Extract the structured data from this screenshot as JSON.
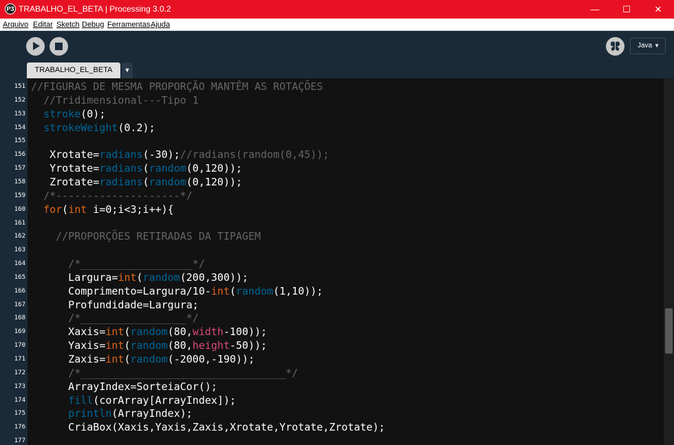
{
  "window": {
    "app_icon": "P3",
    "title": "TRABALHO_EL_BETA | Processing 3.0.2",
    "minimize": "—",
    "maximize": "☐",
    "close": "✕"
  },
  "menu": [
    "Arquivo",
    "Editar",
    "Sketch",
    "Debug",
    "Ferramentas",
    "Ajuda"
  ],
  "toolbar": {
    "mode_label": "Java",
    "mode_arrow": "▼"
  },
  "tabs": {
    "active": "TRABALHO_EL_BETA",
    "menu_arrow": "▼"
  },
  "colors": {
    "titlebar": "#e81123",
    "toolbar": "#1b2a38",
    "editor_bg": "#121212",
    "comment": "#666666",
    "function": "#006699",
    "keyword": "#e2661a",
    "variable": "#d94a7a"
  },
  "editor": {
    "lines": [
      {
        "n": "151",
        "tokens": [
          {
            "t": "c",
            "v": "//FIGURAS DE MESMA PROPORÇÃO MANTÊM AS ROTAÇÕES"
          }
        ]
      },
      {
        "n": "152",
        "tokens": [
          {
            "t": "x",
            "v": "  "
          },
          {
            "t": "c",
            "v": "//Tridimensional---Tipo 1"
          }
        ]
      },
      {
        "n": "153",
        "tokens": [
          {
            "t": "x",
            "v": "  "
          },
          {
            "t": "f",
            "v": "stroke"
          },
          {
            "t": "x",
            "v": "(0);"
          }
        ]
      },
      {
        "n": "154",
        "tokens": [
          {
            "t": "x",
            "v": "  "
          },
          {
            "t": "f",
            "v": "strokeWeight"
          },
          {
            "t": "x",
            "v": "(0.2);"
          }
        ]
      },
      {
        "n": "155",
        "tokens": []
      },
      {
        "n": "156",
        "tokens": [
          {
            "t": "x",
            "v": "   Xrotate="
          },
          {
            "t": "f",
            "v": "radians"
          },
          {
            "t": "x",
            "v": "(-30);"
          },
          {
            "t": "c",
            "v": "//radians(random(0,45));"
          }
        ]
      },
      {
        "n": "157",
        "tokens": [
          {
            "t": "x",
            "v": "   Yrotate="
          },
          {
            "t": "f",
            "v": "radians"
          },
          {
            "t": "x",
            "v": "("
          },
          {
            "t": "f",
            "v": "random"
          },
          {
            "t": "x",
            "v": "(0,120));"
          }
        ]
      },
      {
        "n": "158",
        "tokens": [
          {
            "t": "x",
            "v": "   Zrotate="
          },
          {
            "t": "f",
            "v": "radians"
          },
          {
            "t": "x",
            "v": "("
          },
          {
            "t": "f",
            "v": "random"
          },
          {
            "t": "x",
            "v": "(0,120));"
          }
        ]
      },
      {
        "n": "159",
        "tokens": [
          {
            "t": "x",
            "v": "  "
          },
          {
            "t": "c",
            "v": "/*--------------------*/"
          }
        ]
      },
      {
        "n": "160",
        "tokens": [
          {
            "t": "x",
            "v": "  "
          },
          {
            "t": "k",
            "v": "for"
          },
          {
            "t": "x",
            "v": "("
          },
          {
            "t": "k",
            "v": "int"
          },
          {
            "t": "x",
            "v": " i=0;i<3;i++){"
          }
        ]
      },
      {
        "n": "161",
        "tokens": []
      },
      {
        "n": "162",
        "tokens": [
          {
            "t": "x",
            "v": "    "
          },
          {
            "t": "c",
            "v": "//PROPORÇÕES RETIRADAS DA TIPAGEM"
          }
        ]
      },
      {
        "n": "163",
        "tokens": []
      },
      {
        "n": "164",
        "tokens": [
          {
            "t": "x",
            "v": "      "
          },
          {
            "t": "c",
            "v": "/*__________________*/"
          }
        ]
      },
      {
        "n": "165",
        "tokens": [
          {
            "t": "x",
            "v": "      Largura="
          },
          {
            "t": "k",
            "v": "int"
          },
          {
            "t": "x",
            "v": "("
          },
          {
            "t": "f",
            "v": "random"
          },
          {
            "t": "x",
            "v": "(200,300));"
          }
        ]
      },
      {
        "n": "166",
        "tokens": [
          {
            "t": "x",
            "v": "      Comprimento=Largura/10-"
          },
          {
            "t": "k",
            "v": "int"
          },
          {
            "t": "x",
            "v": "("
          },
          {
            "t": "f",
            "v": "random"
          },
          {
            "t": "x",
            "v": "(1,10));"
          }
        ]
      },
      {
        "n": "167",
        "tokens": [
          {
            "t": "x",
            "v": "      Profundidade=Largura;"
          }
        ]
      },
      {
        "n": "168",
        "tokens": [
          {
            "t": "x",
            "v": "      "
          },
          {
            "t": "c",
            "v": "/*_________________*/"
          }
        ]
      },
      {
        "n": "169",
        "tokens": [
          {
            "t": "x",
            "v": "      Xaxis="
          },
          {
            "t": "k",
            "v": "int"
          },
          {
            "t": "x",
            "v": "("
          },
          {
            "t": "f",
            "v": "random"
          },
          {
            "t": "x",
            "v": "(80,"
          },
          {
            "t": "v",
            "v": "width"
          },
          {
            "t": "x",
            "v": "-100));"
          }
        ]
      },
      {
        "n": "170",
        "tokens": [
          {
            "t": "x",
            "v": "      Yaxis="
          },
          {
            "t": "k",
            "v": "int"
          },
          {
            "t": "x",
            "v": "("
          },
          {
            "t": "f",
            "v": "random"
          },
          {
            "t": "x",
            "v": "(80,"
          },
          {
            "t": "v",
            "v": "height"
          },
          {
            "t": "x",
            "v": "-50));"
          }
        ]
      },
      {
        "n": "171",
        "tokens": [
          {
            "t": "x",
            "v": "      Zaxis="
          },
          {
            "t": "k",
            "v": "int"
          },
          {
            "t": "x",
            "v": "("
          },
          {
            "t": "f",
            "v": "random"
          },
          {
            "t": "x",
            "v": "(-2000,-190));"
          }
        ]
      },
      {
        "n": "172",
        "tokens": [
          {
            "t": "x",
            "v": "      "
          },
          {
            "t": "c",
            "v": "/*_________________________________*/"
          }
        ]
      },
      {
        "n": "173",
        "tokens": [
          {
            "t": "x",
            "v": "      ArrayIndex=SorteiaCor();"
          }
        ]
      },
      {
        "n": "174",
        "tokens": [
          {
            "t": "x",
            "v": "      "
          },
          {
            "t": "f",
            "v": "fill"
          },
          {
            "t": "x",
            "v": "(corArray[ArrayIndex]);"
          }
        ]
      },
      {
        "n": "175",
        "tokens": [
          {
            "t": "x",
            "v": "      "
          },
          {
            "t": "f",
            "v": "println"
          },
          {
            "t": "x",
            "v": "(ArrayIndex);"
          }
        ]
      },
      {
        "n": "176",
        "tokens": [
          {
            "t": "x",
            "v": "      CriaBox(Xaxis,Yaxis,Zaxis,Xrotate,Yrotate,Zrotate);"
          }
        ]
      },
      {
        "n": "177",
        "tokens": []
      }
    ]
  }
}
